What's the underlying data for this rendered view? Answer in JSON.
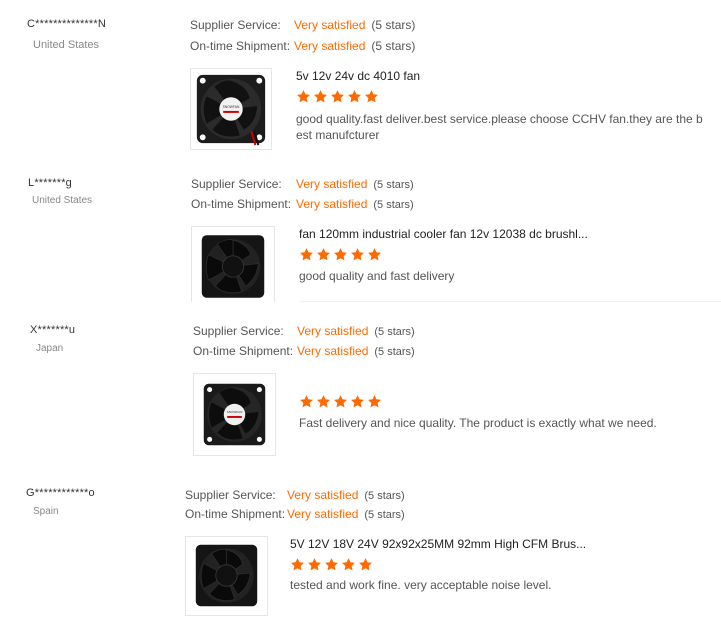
{
  "colors": {
    "accent": "#ff6a00",
    "star": "#ff6a00"
  },
  "reviews": [
    {
      "buyer": "C**************N",
      "country": "United States",
      "supplier_label": "Supplier Service:",
      "supplier_value": "Very satisfied",
      "supplier_stars": "(5 stars)",
      "shipment_label": "On-time Shipment:",
      "shipment_value": "Very satisfied",
      "shipment_stars": "(5 stars)",
      "product_title": "5v 12v 24v dc 4010 fan",
      "rating": 5,
      "comment": "good quality.fast deliver.best service.please choose CCHV fan.they are the b est manufcturer",
      "thumb_icon": "fan-icon"
    },
    {
      "buyer": "L*******g",
      "country": "United States",
      "supplier_label": "Supplier Service:",
      "supplier_value": "Very satisfied",
      "supplier_stars": "(5 stars)",
      "shipment_label": "On-time Shipment:",
      "shipment_value": "Very satisfied",
      "shipment_stars": "(5 stars)",
      "product_title": "fan 120mm industrial cooler fan 12v 12038 dc brushl...",
      "rating": 5,
      "comment": "good quality and fast delivery",
      "thumb_icon": "fan-icon"
    },
    {
      "buyer": "X*******u",
      "country": "Japan",
      "supplier_label": "Supplier Service:",
      "supplier_value": "Very satisfied",
      "supplier_stars": "(5 stars)",
      "shipment_label": "On-time Shipment:",
      "shipment_value": "Very satisfied",
      "shipment_stars": "(5 stars)",
      "product_title": "",
      "rating": 5,
      "comment": "Fast delivery and nice quality. The product is exactly what we need.",
      "thumb_icon": "fan-icon"
    },
    {
      "buyer": "G************o",
      "country": "Spain",
      "supplier_label": "Supplier Service:",
      "supplier_value": "Very satisfied",
      "supplier_stars": "(5 stars)",
      "shipment_label": "On-time Shipment:",
      "shipment_value": "Very satisfied",
      "shipment_stars": "(5 stars)",
      "product_title": "5V 12V 18V 24V 92x92x25MM 92mm High CFM Brus...",
      "rating": 5,
      "comment": "tested and work fine.  very acceptable noise level.",
      "thumb_icon": "fan-icon"
    }
  ]
}
